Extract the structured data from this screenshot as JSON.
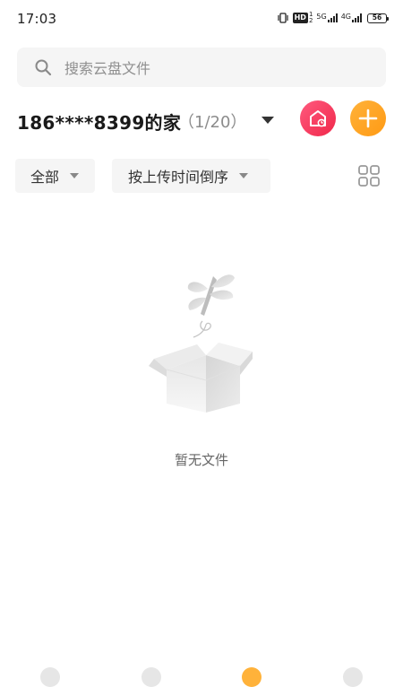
{
  "status_bar": {
    "time": "17:03",
    "hd_label": "HD",
    "hd_sub_top": "1",
    "hd_sub_bottom": "2",
    "net1_label": "5G",
    "net2_label": "4G",
    "battery_level": "56"
  },
  "search": {
    "placeholder": "搜索云盘文件"
  },
  "header": {
    "home_name": "186****8399的家",
    "count": "（1/20）"
  },
  "filters": {
    "type_label": "全部",
    "sort_label": "按上传时间倒序"
  },
  "empty_state": {
    "message": "暂无文件"
  },
  "colors": {
    "home_button": "#f0284a",
    "add_button": "#ff9a14"
  },
  "icons": {
    "search": "search-icon",
    "dropdown": "triangle-down-icon",
    "home": "home-clock-icon",
    "add": "plus-icon",
    "grid": "grid-view-icon"
  }
}
